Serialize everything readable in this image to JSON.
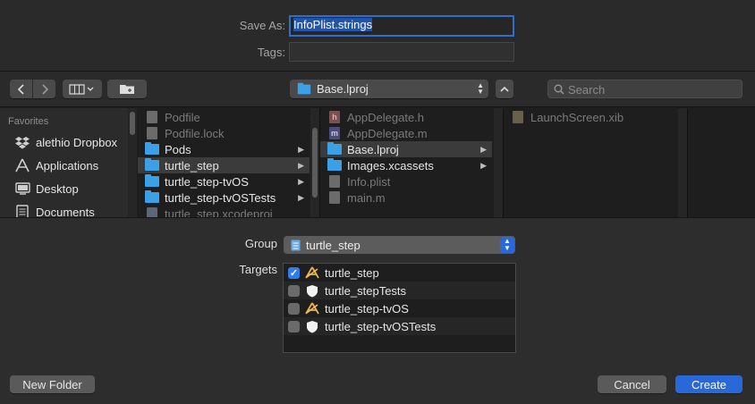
{
  "dialog": {
    "save_as_label": "Save As:",
    "save_as_value": "InfoPlist.strings",
    "tags_label": "Tags:",
    "tags_value": ""
  },
  "toolbar": {
    "back_icon": "chevron-left",
    "forward_icon": "chevron-right",
    "view_icon": "column-view",
    "new_folder_icon": "folder",
    "location": "Base.lproj",
    "search_placeholder": "Search"
  },
  "sidebar": {
    "header": "Favorites",
    "items": [
      {
        "label": "alethio Dropbox",
        "icon": "dropbox"
      },
      {
        "label": "Applications",
        "icon": "applications"
      },
      {
        "label": "Desktop",
        "icon": "desktop"
      },
      {
        "label": "Documents",
        "icon": "documents"
      }
    ]
  },
  "columns": [
    {
      "rows": [
        {
          "name": "Podfile",
          "kind": "doc",
          "enabled": false,
          "folder": false
        },
        {
          "name": "Podfile.lock",
          "kind": "doc",
          "enabled": false,
          "folder": false
        },
        {
          "name": "Pods",
          "kind": "folder",
          "enabled": true,
          "folder": true
        },
        {
          "name": "turtle_step",
          "kind": "folder",
          "enabled": true,
          "folder": true,
          "selected": true
        },
        {
          "name": "turtle_step-tvOS",
          "kind": "folder",
          "enabled": true,
          "folder": true
        },
        {
          "name": "turtle_step-tvOSTests",
          "kind": "folder",
          "enabled": true,
          "folder": true
        },
        {
          "name": "turtle_step.xcodeproj",
          "kind": "proj",
          "enabled": false,
          "folder": false
        }
      ]
    },
    {
      "rows": [
        {
          "name": "AppDelegate.h",
          "kind": "h",
          "enabled": false,
          "folder": false
        },
        {
          "name": "AppDelegate.m",
          "kind": "m",
          "enabled": false,
          "folder": false
        },
        {
          "name": "Base.lproj",
          "kind": "folder",
          "enabled": true,
          "folder": true,
          "selected": true
        },
        {
          "name": "Images.xcassets",
          "kind": "folder",
          "enabled": true,
          "folder": true
        },
        {
          "name": "Info.plist",
          "kind": "doc",
          "enabled": false,
          "folder": false
        },
        {
          "name": "main.m",
          "kind": "doc",
          "enabled": false,
          "folder": false
        }
      ]
    },
    {
      "rows": [
        {
          "name": "LaunchScreen.xib",
          "kind": "xib",
          "enabled": false,
          "folder": false
        }
      ]
    }
  ],
  "group": {
    "label": "Group",
    "value": "turtle_step"
  },
  "targets": {
    "label": "Targets",
    "items": [
      {
        "name": "turtle_step",
        "checked": true,
        "icon": "app"
      },
      {
        "name": "turtle_stepTests",
        "checked": false,
        "icon": "shield"
      },
      {
        "name": "turtle_step-tvOS",
        "checked": false,
        "icon": "app"
      },
      {
        "name": "turtle_step-tvOSTests",
        "checked": false,
        "icon": "shield"
      }
    ]
  },
  "buttons": {
    "new_folder": "New Folder",
    "cancel": "Cancel",
    "create": "Create"
  }
}
